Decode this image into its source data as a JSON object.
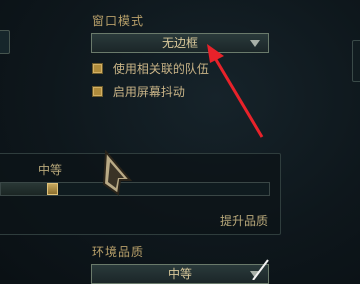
{
  "window_mode": {
    "heading": "窗口模式",
    "selected": "无边框"
  },
  "checkboxes": [
    {
      "label": "使用相关联的队伍",
      "checked": true
    },
    {
      "label": "启用屏幕抖动",
      "checked": true
    }
  ],
  "quality_slider": {
    "label": "中等",
    "value_fraction": 0.19,
    "link": "提升品质"
  },
  "environment_quality": {
    "heading": "环境品质",
    "selected": "中等"
  },
  "colors": {
    "accent_gold": "#c8aa6e",
    "annotation_red": "#e8222a"
  },
  "icons": [
    "dropdown-arrow-icon",
    "pointer-cursor-icon",
    "checkbox-icon"
  ]
}
